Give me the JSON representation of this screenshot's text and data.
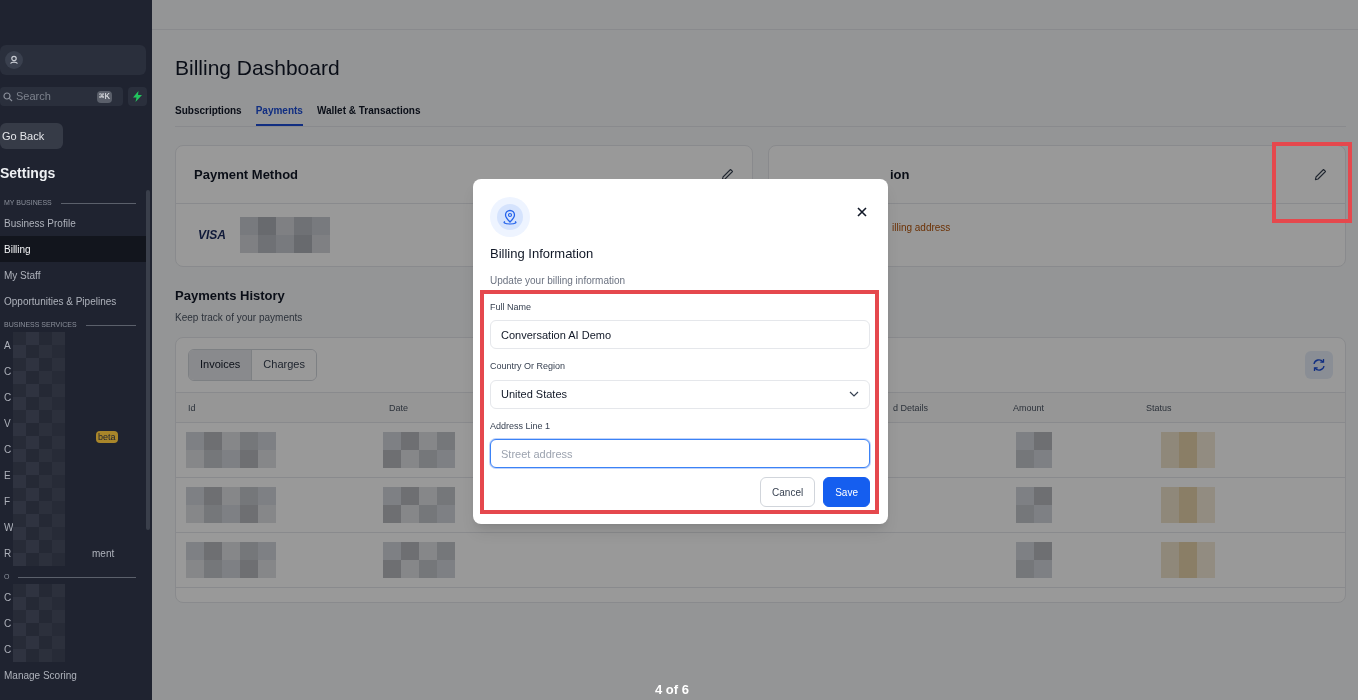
{
  "sidebar": {
    "search": {
      "placeholder": "Search",
      "shortcut": "⌘K"
    },
    "back_button": "Go Back",
    "heading": "Settings",
    "sections": [
      {
        "title": "MY BUSINESS",
        "items": [
          {
            "label": "Business Profile",
            "selected": false
          },
          {
            "label": "Billing",
            "selected": true
          },
          {
            "label": "My Staff",
            "selected": false
          },
          {
            "label": "Opportunities & Pipelines",
            "selected": false
          }
        ]
      },
      {
        "title": "BUSINESS SERVICES",
        "items": [
          {
            "label": "A",
            "redacted": true
          },
          {
            "label": "C",
            "redacted": true
          },
          {
            "label": "C",
            "redacted": true
          },
          {
            "label": "V",
            "redacted": true
          },
          {
            "label": "C",
            "redacted": true,
            "badge": "beta"
          },
          {
            "label": "E",
            "redacted": true
          },
          {
            "label": "F",
            "redacted": true
          },
          {
            "label": "W",
            "redacted": true
          },
          {
            "label": "R",
            "redacted": true,
            "label_end": "ment"
          }
        ]
      },
      {
        "title": "O",
        "items": [
          {
            "label": "C",
            "redacted": true
          },
          {
            "label": "C",
            "redacted": true
          },
          {
            "label": "C",
            "redacted": true
          },
          {
            "label": "Manage Scoring",
            "redacted": false
          }
        ]
      }
    ]
  },
  "page": {
    "title": "Billing Dashboard",
    "tabs": [
      {
        "label": "Subscriptions",
        "selected": false
      },
      {
        "label": "Payments",
        "selected": true
      },
      {
        "label": "Wallet & Transactions",
        "selected": false
      }
    ],
    "payment_method": {
      "title": "Payment Method",
      "card_brand": "VISA"
    },
    "billing_information": {
      "title": "ion",
      "notice": "illing address"
    },
    "payments_history": {
      "title": "Payments History",
      "subtitle": "Keep track of your payments",
      "toggle": [
        {
          "label": "Invoices",
          "selected": true
        },
        {
          "label": "Charges",
          "selected": false
        }
      ],
      "table": {
        "columns": [
          "Id",
          "Date",
          "d Details",
          "Amount",
          "Status"
        ],
        "rows": [
          {
            "kind": "redacted"
          },
          {
            "kind": "redacted"
          },
          {
            "kind": "redacted"
          }
        ]
      }
    },
    "pager": "4 of 6"
  },
  "modal": {
    "title": "Billing Information",
    "subtitle": "Update your billing information",
    "fields": [
      {
        "kind": "text",
        "label": "Full Name",
        "value": "Conversation AI Demo",
        "focused": false
      },
      {
        "kind": "select",
        "label": "Country Or Region",
        "value": "United States",
        "focused": false
      },
      {
        "kind": "text",
        "label": "Address Line 1",
        "placeholder": "Street address",
        "focused": true
      }
    ],
    "buttons": [
      {
        "label": "Cancel",
        "kind": "secondary"
      },
      {
        "label": "Save",
        "kind": "primary"
      }
    ]
  }
}
